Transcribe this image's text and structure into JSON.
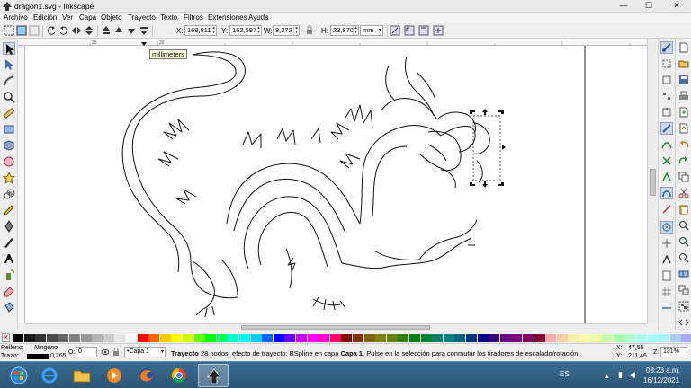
{
  "window": {
    "title": "dragon1.svg - Inkscape",
    "controls": {
      "minimize": "—",
      "maximize": "☐",
      "close": "✕"
    }
  },
  "menu": [
    "Archivo",
    "Edición",
    "Ver",
    "Capa",
    "Objeto",
    "Trayecto",
    "Texto",
    "Filtros",
    "Extensiones",
    "Ayuda"
  ],
  "toolbar": {
    "x_label": "X:",
    "x_value": "169,811",
    "y_label": "Y:",
    "y_value": "162,597",
    "w_label": "W:",
    "w_value": "8,372",
    "h_label": "H:",
    "h_value": "23,870",
    "unit": "mm"
  },
  "rulers": {
    "ticks": [
      "25",
      "30",
      "75",
      "100",
      "125",
      "150",
      "175",
      "200",
      "225",
      "250",
      "275",
      "300",
      "325",
      "350",
      "375",
      "400",
      "425",
      "450"
    ]
  },
  "canvas": {
    "tooltip": "millimeters"
  },
  "left_tools": [
    "selector-icon",
    "node-icon",
    "tweak-icon",
    "zoom-icon",
    "measure-icon",
    "rect-icon",
    "3dbox-icon",
    "ellipse-icon",
    "star-icon",
    "spiral-icon",
    "pencil-icon",
    "pen-icon",
    "calligraphy-icon",
    "text-icon",
    "spray-icon",
    "eraser-icon",
    "bucket-icon"
  ],
  "palette": {
    "colors": [
      "#000000",
      "#1a1a1a",
      "#333333",
      "#4d4d4d",
      "#666666",
      "#808080",
      "#999999",
      "#b3b3b3",
      "#cccccc",
      "#e6e6e6",
      "#ffffff",
      "#ff0000",
      "#ff6600",
      "#ffcc00",
      "#ffff00",
      "#ccff00",
      "#66ff00",
      "#00ff00",
      "#00ff66",
      "#00ffcc",
      "#00ffff",
      "#00ccff",
      "#0066ff",
      "#0000ff",
      "#6600ff",
      "#cc00ff",
      "#ff00ff",
      "#ff00cc",
      "#ff0066",
      "#800000",
      "#803300",
      "#806600",
      "#808000",
      "#668000",
      "#338000",
      "#008000",
      "#008033",
      "#008066",
      "#008080",
      "#006680",
      "#003380",
      "#000080",
      "#330080",
      "#660080",
      "#800080",
      "#800066",
      "#800033",
      "#ffaaaa",
      "#ffccaa",
      "#ffeeaa",
      "#ffffaa",
      "#eeffaa",
      "#ccffaa",
      "#aaffaa",
      "#aaffcc",
      "#aaffee",
      "#aaffff",
      "#aaeeff",
      "#aaccff",
      "#aaaaff"
    ]
  },
  "status": {
    "fill_label": "Relleno:",
    "fill_value": "Ninguno",
    "stroke_label": "Trazo:",
    "stroke_width": "0,265",
    "opacity_label": "O:",
    "opacity_value": "0",
    "layer": "•Capa 1",
    "message_bold": "Trayecto",
    "message_1": " 28 nodos, efecto de trayecto: BSpline en capa ",
    "message_layer": "Capa 1",
    "message_2": ". Pulse en la selección para conmutar los tiradores de escalado/rotación.",
    "x_label": "X:",
    "x": "47,55",
    "y_label": "Y:",
    "y": "211,46",
    "z_label": "Z:",
    "zoom": "131%"
  },
  "taskbar": {
    "language": "ES",
    "time": "08:23 a.m.",
    "date": "16/12/2021",
    "apps": [
      "start-orb",
      "ie-icon",
      "explorer-icon",
      "media-player-icon",
      "firefox-icon",
      "chrome-icon",
      "inkscape-icon"
    ]
  }
}
